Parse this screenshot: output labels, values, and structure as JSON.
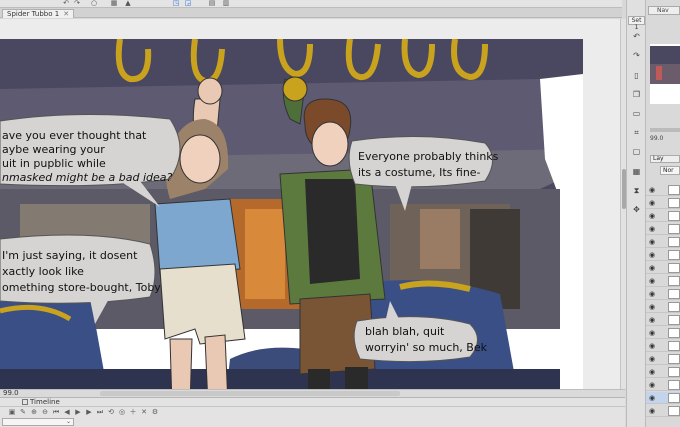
{
  "document": {
    "tab_title": "Spider Tubbo 1",
    "close_glyph": "✕"
  },
  "comic": {
    "bubble_left_top": [
      "ave you ever thought that",
      "aybe wearing your",
      "uit in pupblic while",
      "nmasked might be a bad idea?"
    ],
    "bubble_left_bottom": [
      "I'm just saying, it dosent",
      "xactly look like",
      "omething store-bought, Toby"
    ],
    "bubble_right_top": [
      "Everyone probably thinks",
      "its a costume, Its fine-"
    ],
    "bubble_right_bottom": [
      "blah blah, quit",
      "worryin' so much, Bek"
    ]
  },
  "statusbar": {
    "zoom": "99.0"
  },
  "timeline": {
    "title": "Timeline"
  },
  "toolbar_right": {
    "set_tab": "Set 1"
  },
  "navigator": {
    "tab": "Nav",
    "zoom": "99.0"
  },
  "layers": {
    "tab": "Lay",
    "blend_mode": "Nor"
  },
  "colors": {
    "sky": "#4a4760",
    "bus_interior": "#5b5a66",
    "handle_yellow": "#c9a21e",
    "seat_blue": "#3a4f86",
    "bubble_fill": "#d6d4d2",
    "selection_blue": "#2a6fd6"
  }
}
